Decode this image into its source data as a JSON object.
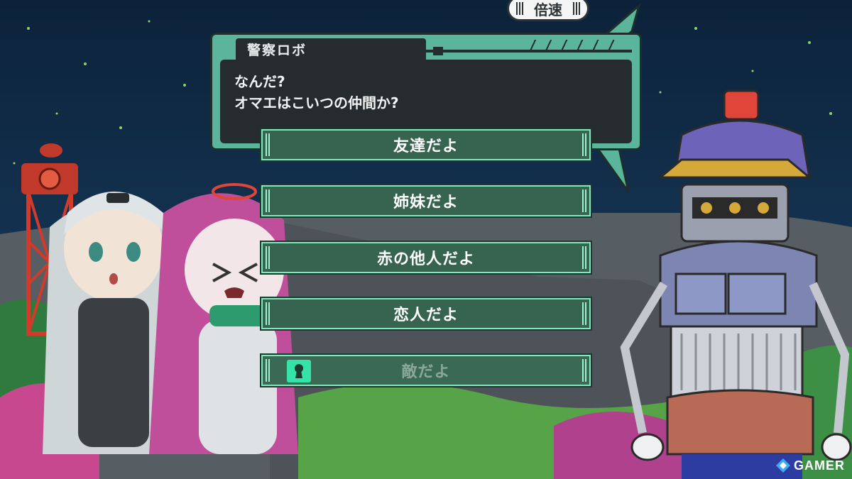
{
  "hud": {
    "speed_label": "倍速"
  },
  "dialog": {
    "speaker": "警察ロボ",
    "lines": [
      "なんだ?",
      "オマエはこいつの仲間か?"
    ]
  },
  "choices": [
    {
      "label": "友達だよ",
      "locked": false
    },
    {
      "label": "姉妹だよ",
      "locked": false
    },
    {
      "label": "赤の他人だよ",
      "locked": false
    },
    {
      "label": "恋人だよ",
      "locked": false
    },
    {
      "label": "敵だよ",
      "locked": true,
      "icon": "keyhole-lock-icon"
    }
  ],
  "watermark": {
    "text": "GAMER"
  },
  "colors": {
    "dialog_frame": "#5bb59a",
    "dialog_bg": "#262c2e",
    "choice_bg": "#37644f",
    "choice_border": "#7fe8bd",
    "lock_icon": "#35e3a9"
  }
}
